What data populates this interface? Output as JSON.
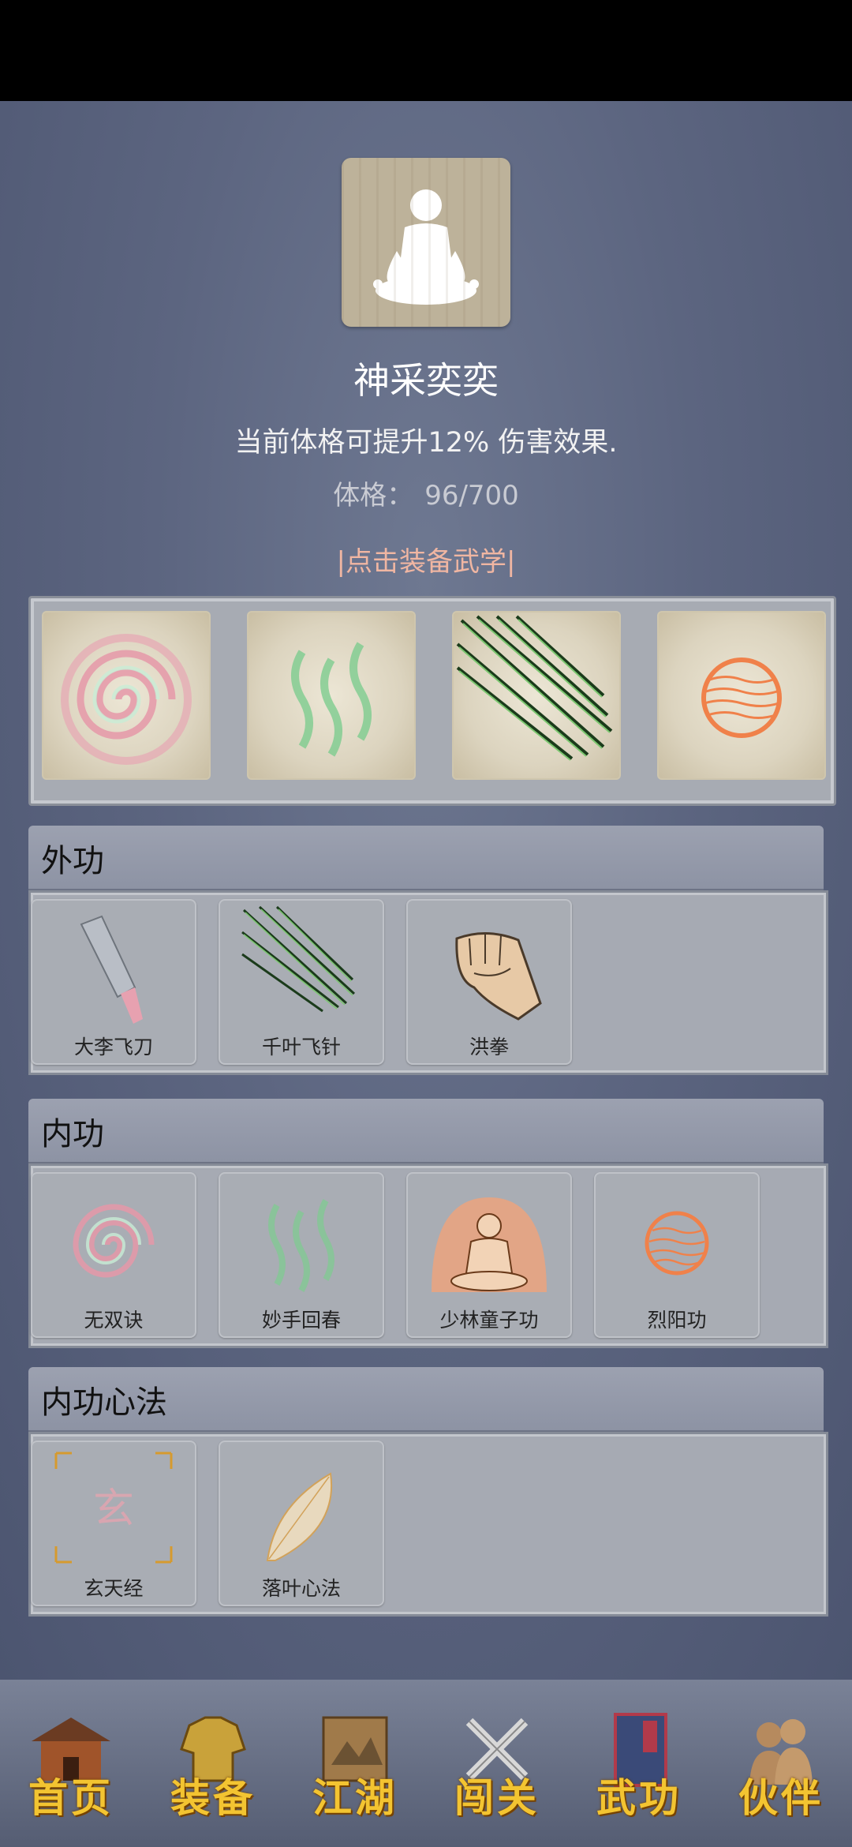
{
  "header": {
    "title": "神采奕奕",
    "description": "当前体格可提升12% 伤害效果.",
    "stat_label": "体格：",
    "stat_value": "96/700",
    "equip_link": "|点击装备武学|"
  },
  "sections": [
    {
      "title": "外功",
      "items": [
        "大李飞刀",
        "千叶飞针",
        "洪拳"
      ]
    },
    {
      "title": "内功",
      "items": [
        "无双诀",
        "妙手回春",
        "少林童子功",
        "烈阳功"
      ]
    },
    {
      "title": "内功心法",
      "items": [
        "玄天经",
        "落叶心法"
      ]
    }
  ],
  "equipped_slots": [
    "spiral-icon",
    "green-waves-icon",
    "green-needles-icon",
    "orange-sun-icon"
  ],
  "bottom_nav": [
    "首页",
    "装备",
    "江湖",
    "闯关",
    "武功",
    "伙伴"
  ],
  "colors": {
    "accent_link": "#f0b6a2",
    "nav_label": "#f3c431"
  }
}
